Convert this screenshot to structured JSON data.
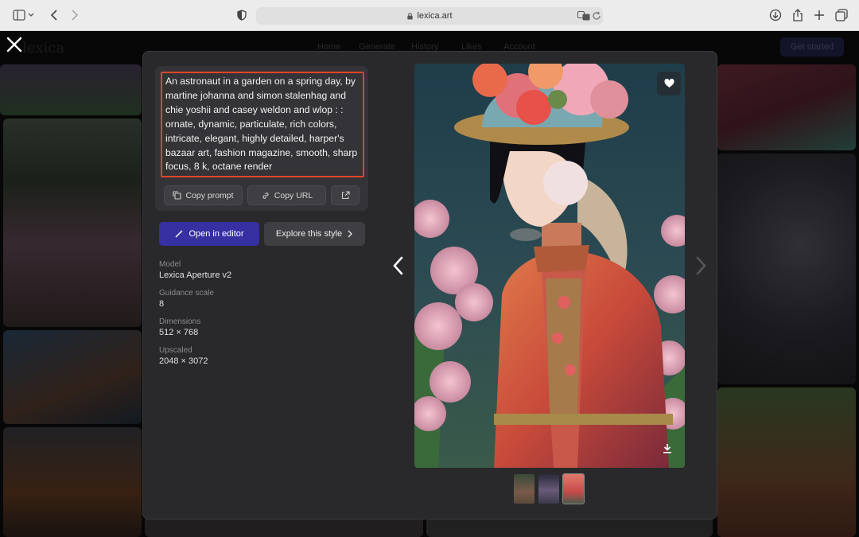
{
  "browser": {
    "url": "lexica.art"
  },
  "site": {
    "logo": "lexica",
    "nav": [
      "Home",
      "Generate",
      "History",
      "Likes",
      "Account"
    ],
    "get_started": "Get started"
  },
  "modal": {
    "prompt": "An astronaut in a garden on a spring day, by martine johanna and simon stalenhag and chie yoshii and casey weldon and wlop : : ornate, dynamic, particulate, rich colors, intricate, elegant, highly detailed, harper's bazaar art, fashion magazine, smooth, sharp focus, 8 k, octane render",
    "copy_prompt": "Copy prompt",
    "copy_url": "Copy URL",
    "open_in_editor": "Open in editor",
    "explore_style": "Explore this style",
    "meta": [
      {
        "label": "Model",
        "value": "Lexica Aperture v2"
      },
      {
        "label": "Guidance scale",
        "value": "8"
      },
      {
        "label": "Dimensions",
        "value": "512 × 768"
      },
      {
        "label": "Upscaled",
        "value": "2048 × 3072"
      }
    ]
  },
  "colors": {
    "accent_button": "#3730a3",
    "highlight_border": "#e0452a"
  },
  "icons": [
    "close-icon",
    "heart-icon",
    "download-icon",
    "prev-arrow-icon",
    "next-arrow-icon",
    "copy-icon",
    "link-icon",
    "external-link-icon",
    "wand-icon",
    "chevron-right-icon"
  ]
}
